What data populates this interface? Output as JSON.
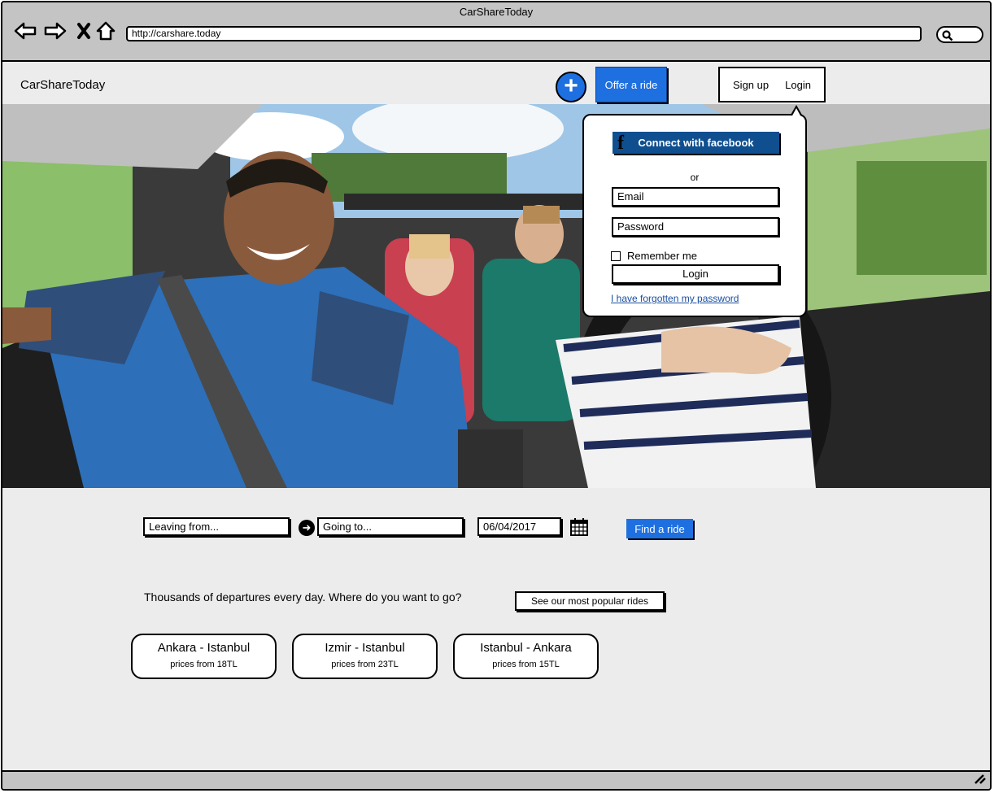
{
  "window": {
    "title": "CarShareToday"
  },
  "browser": {
    "url": "http://carshare.today"
  },
  "header": {
    "logo": "CarShareToday",
    "offer_label": "Offer a ride",
    "signup_label": "Sign up",
    "login_label": "Login"
  },
  "login_popup": {
    "facebook_label": "Connect with facebook",
    "or_label": "or",
    "email_placeholder": "Email",
    "password_placeholder": "Password",
    "remember_label": "Remember me",
    "login_button": "Login",
    "forgot_link": "I have forgotten my password"
  },
  "search": {
    "leaving_placeholder": "Leaving from...",
    "going_placeholder": "Going to...",
    "date_value": "06/04/2017",
    "find_label": "Find a ride"
  },
  "promo": {
    "tagline": "Thousands of departures every day. Where do you want to go?",
    "popular_label": "See our most popular rides"
  },
  "rides": [
    {
      "route": "Ankara - Istanbul",
      "price": "prices from 18TL"
    },
    {
      "route": "Izmir - Istanbul",
      "price": "prices from 23TL"
    },
    {
      "route": "Istanbul - Ankara",
      "price": "prices from 15TL"
    }
  ],
  "colors": {
    "accent": "#1e6fe0",
    "facebook": "#0f4f8f",
    "chrome": "#c4c4c4",
    "page": "#ececec"
  }
}
